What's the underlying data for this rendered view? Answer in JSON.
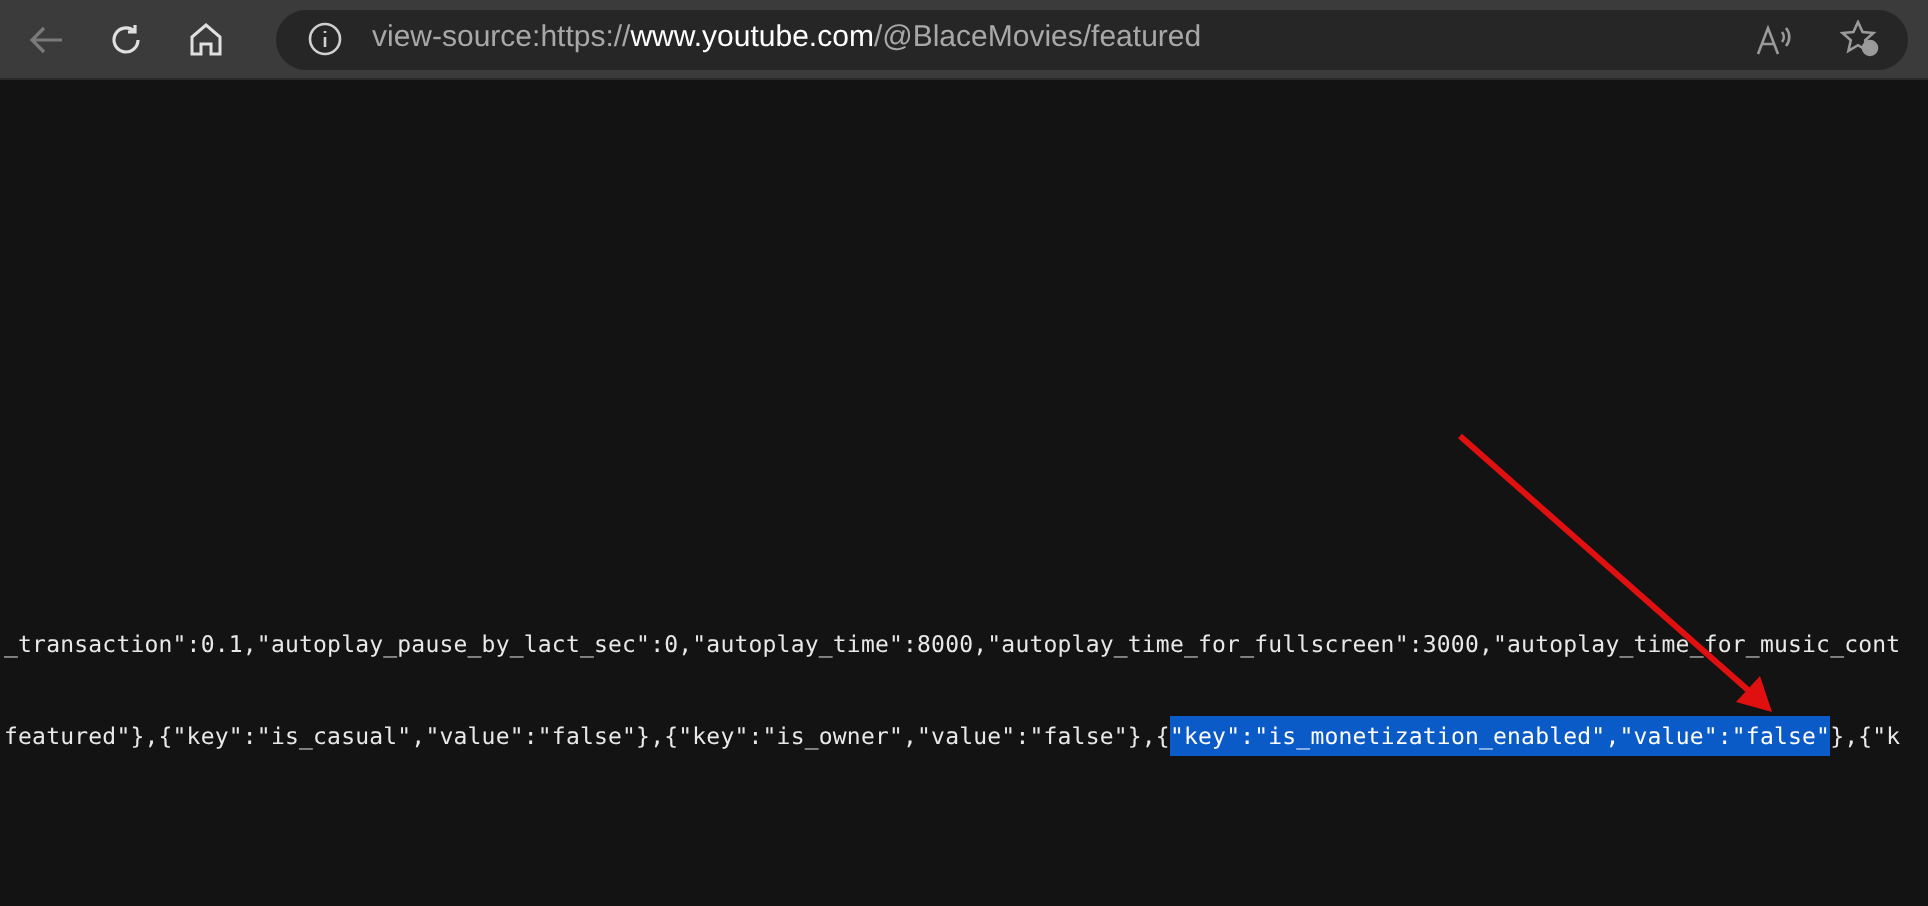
{
  "toolbar": {
    "url": "view-source:https://**www.youtube.com**/@BlaceMovies/featured"
  },
  "code_lines": [
    {
      "segments": [
        {
          "text": "_transaction\":0.1,\"autoplay_pause_by_lact_sec\":0,\"autoplay_time\":8000,\"autoplay_time_for_fullscreen\":3000,\"autoplay_time_for_music_cont",
          "selected": false
        }
      ]
    },
    {
      "segments": [
        {
          "text": "featured\"},{\"key\":\"is_casual\",\"value\":\"false\"},{\"key\":\"is_owner\",\"value\":\"false\"},{",
          "selected": false
        },
        {
          "text": "\"key\":\"is_monetization_enabled\",\"value\":\"false\"",
          "selected": true
        },
        {
          "text": "},{\"k",
          "selected": false
        }
      ]
    }
  ]
}
